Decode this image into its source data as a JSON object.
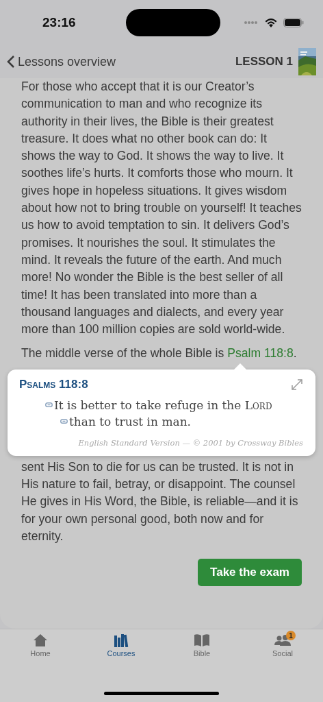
{
  "status_bar": {
    "time": "23:16"
  },
  "nav": {
    "back_label": "Lessons overview",
    "lesson_label": "LESSON 1"
  },
  "paragraphs": [
    {
      "text": "For those who accept that it is our Creator’s communication to man and who recognize its authority in their lives, the Bible is their greatest treasure. It does what no other book can do: It shows the way to God. It shows the way to live. It soothes life’s hurts. It comforts those who mourn. It gives hope in hopeless situations. It gives wisdom about how not to bring trouble on yourself! It teaches us how to avoid temptation to sin. It delivers God’s promises. It nourishes the soul. It stimulates the mind. It reveals the future of the earth. And much more! No wonder the Bible is the best seller of all time! It has been translated into more than a thousand languages and dialects, and every year more than 100 million copies are sold world-wide."
    }
  ],
  "verse_line": {
    "text": "The middle verse of the whole Bible is",
    "link": "Psalm 118:8",
    "end": "."
  },
  "popup": {
    "reference": "Psalms 118:8",
    "lines": [
      {
        "text": "It is better to take refuge in the",
        "divine_name": "Lord"
      },
      {
        "text": "than to trust in man."
      }
    ],
    "copyright": "English Standard Version — © 2001 by Crossway Bibles"
  },
  "after_text": "sent His Son to die for us can be trusted. It is not in His nature to fail, betray, or disappoint. The counsel He gives in His Word, the Bible, is reliable—and it is for your own personal good, both now and for eternity.",
  "exam_button": "Take the exam",
  "tabs": [
    {
      "label": "Home",
      "selected": false,
      "kind": "home"
    },
    {
      "label": "Courses",
      "selected": true,
      "kind": "courses"
    },
    {
      "label": "Bible",
      "selected": false,
      "kind": "bible"
    },
    {
      "label": "Social",
      "selected": false,
      "kind": "social",
      "badge": "1"
    }
  ]
}
